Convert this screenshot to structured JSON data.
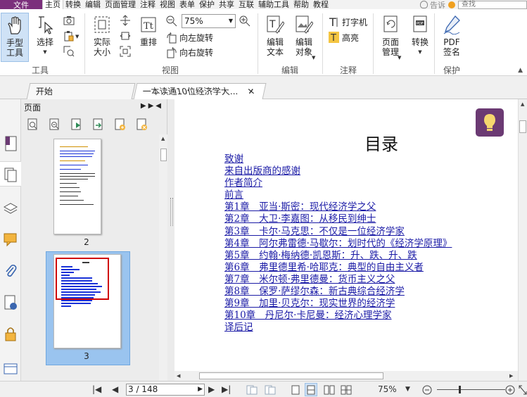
{
  "menubar": {
    "file_label": "文件",
    "items": [
      "主页",
      "转换",
      "编辑",
      "页面管理",
      "注释",
      "视图",
      "表单",
      "保护",
      "共享",
      "互联",
      "辅助工具",
      "帮助",
      "教程"
    ],
    "tell_me": "告诉",
    "search_placeholder": "查找"
  },
  "ribbon": {
    "hand_tool": "手型\n工具",
    "select": "选择",
    "group_tools": "工具",
    "actual_size": "实际\n大小",
    "reflow": "重排",
    "zoom_value": "75%",
    "rotate_left": "向左旋转",
    "rotate_right": "向右旋转",
    "group_view": "视图",
    "edit_text": "编辑\n文本",
    "edit_object": "编辑\n对象",
    "group_edit": "编辑",
    "typewriter": "打字机",
    "highlight": "高亮",
    "group_comment": "注释",
    "page_manage": "页面\n管理",
    "convert": "转换",
    "pdf_sign": "PDF\n签名",
    "group_protect": "保护"
  },
  "tabs": {
    "start": "开始",
    "doc": "一本读通10位经济学大..."
  },
  "panel": {
    "title": "页面",
    "pages": [
      {
        "number": "2"
      },
      {
        "number": "3"
      }
    ]
  },
  "document": {
    "title": "目录",
    "toc": [
      "致谢",
      "来自出版商的感谢",
      "作者简介",
      "前言",
      "第1章　亚当·斯密：现代经济学之父",
      "第2章　大卫·李嘉图：从移民到绅士",
      "第3章　卡尔·马克思：不仅是一位经济学家",
      "第4章　阿尔弗雷德·马歇尔：划时代的《经济学原理》",
      "第5章　约翰·梅纳德·凯恩斯：升、跌、升、跌",
      "第6章　弗里德里希·哈耶克：典型的自由主义者",
      "第7章　米尔顿·弗里德曼：货币主义之父",
      "第8章　保罗·萨缪尔森：新古典综合经济学",
      "第9章　加里·贝克尔：现实世界的经济学",
      "第10章　丹尼尔·卡尼曼：经济心理学家",
      "译后记"
    ]
  },
  "statusbar": {
    "page_indicator": "3 / 148",
    "zoom": "75%"
  },
  "colors": {
    "file_menu": "#7b2f7c",
    "link": "#1a1aa6",
    "selection": "#9ac4ef",
    "bulb": "#6b3a73",
    "thumb_highlight": "#d00000"
  }
}
